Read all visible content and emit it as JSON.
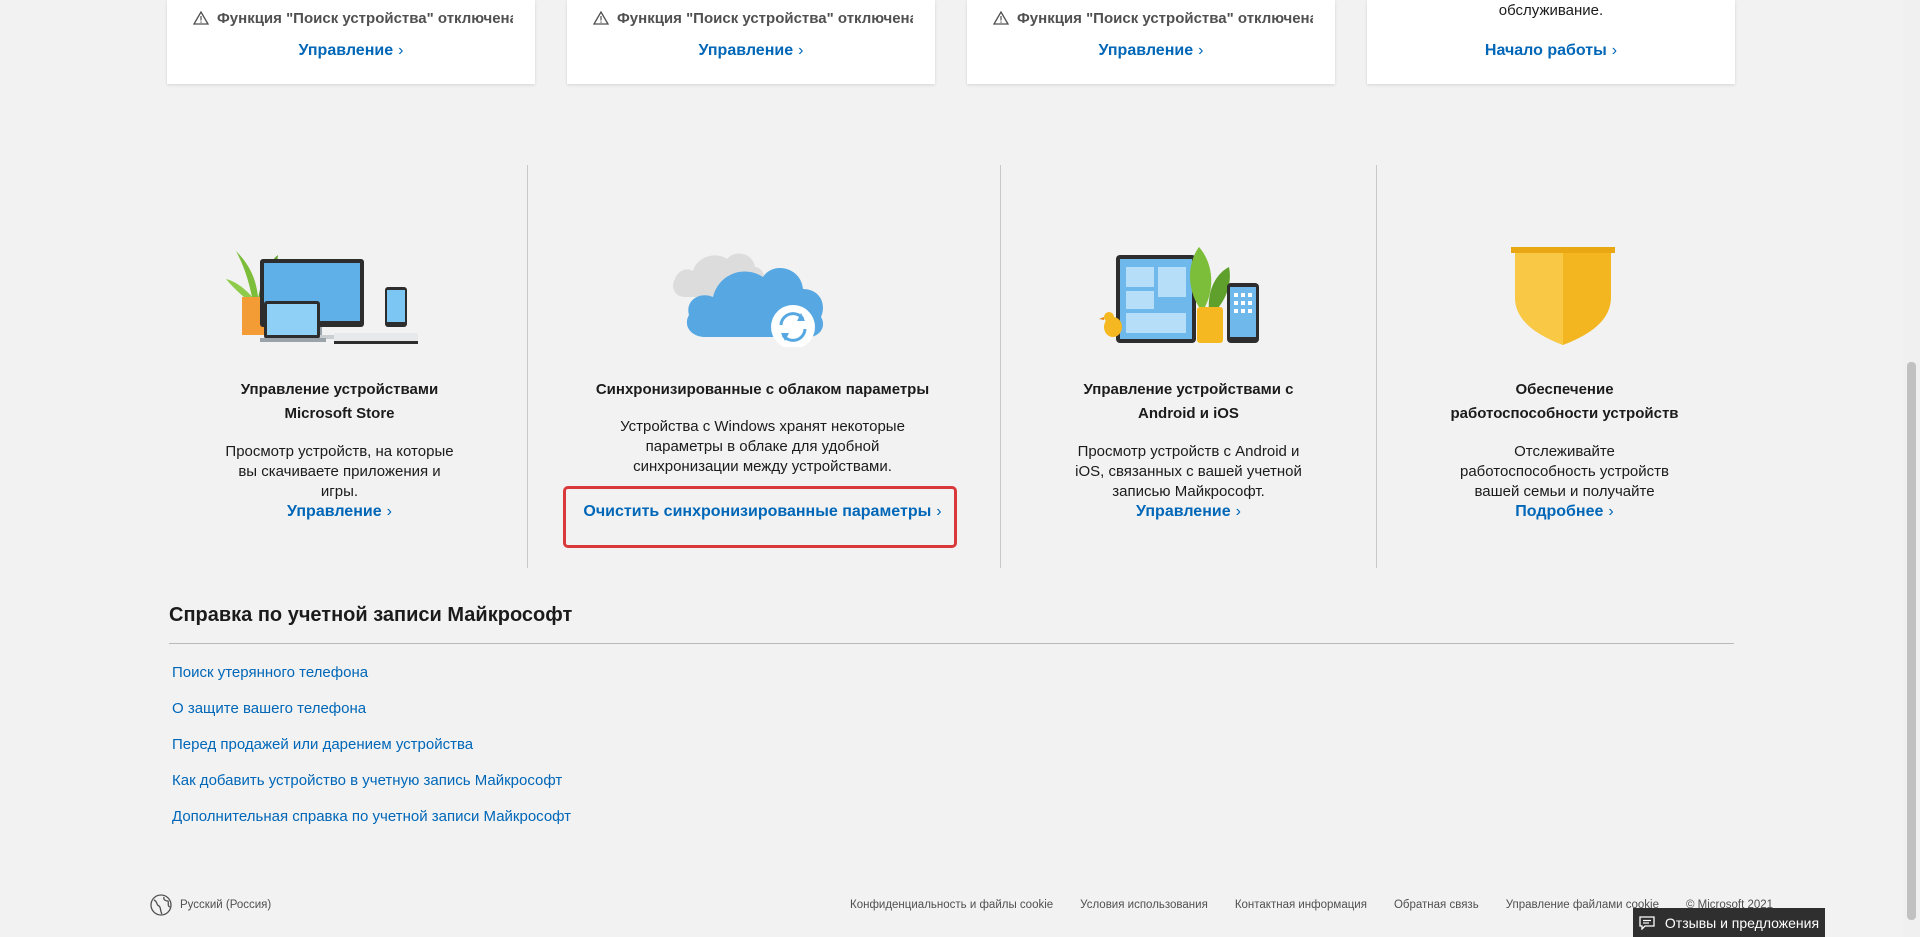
{
  "top_cards": [
    {
      "warning": "Функция \"Поиск устройства\" отключена",
      "link": "Управление"
    },
    {
      "warning": "Функция \"Поиск устройства\" отключена",
      "link": "Управление"
    },
    {
      "warning": "Функция \"Поиск устройства\" отключена",
      "link": "Управление"
    },
    {
      "upper_text": "обслуживание.",
      "link": "Начало работы"
    }
  ],
  "features": [
    {
      "title_line1": "Управление устройствами",
      "title_line2": "Microsoft Store",
      "description_lines": [
        "Просмотр устройств, на которые",
        "вы скачиваете приложения и",
        "игры."
      ],
      "link": "Управление"
    },
    {
      "title_line1": "Синхронизированные с облаком параметры",
      "title_line2": "",
      "description_lines": [
        "Устройства с Windows хранят некоторые",
        "параметры в облаке для удобной",
        "синхронизации между устройствами."
      ],
      "link": "Очистить синхронизированные параметры"
    },
    {
      "title_line1": "Управление устройствами с",
      "title_line2": "Android и iOS",
      "description_lines": [
        "Просмотр устройств с Android и",
        "iOS, связанных с вашей учетной",
        "записью Майкрософт."
      ],
      "link": "Управление"
    },
    {
      "title_line1": "Обеспечение",
      "title_line2": "работоспособности устройств",
      "description_lines": [
        "Отслеживайте",
        "работоспособность устройств",
        "вашей семьи и получайте"
      ],
      "link": "Подробнее"
    }
  ],
  "help": {
    "title": "Справка по учетной записи Майкрософт",
    "links": [
      "Поиск утерянного телефона",
      "О защите вашего телефона",
      "Перед продажей или дарением устройства",
      "Как добавить устройство в учетную запись Майкрософт",
      "Дополнительная справка по учетной записи Майкрософт"
    ]
  },
  "footer": {
    "language": "Русский (Россия)",
    "links": [
      "Конфиденциальность и файлы cookie",
      "Условия использования",
      "Контактная информация",
      "Обратная связь",
      "Управление файлами cookie",
      "© Microsoft 2021"
    ]
  },
  "feedback_button": "Отзывы и предложения",
  "colors": {
    "link": "#0067b8",
    "highlight": "#d9393a",
    "background": "#f2f2f2"
  }
}
